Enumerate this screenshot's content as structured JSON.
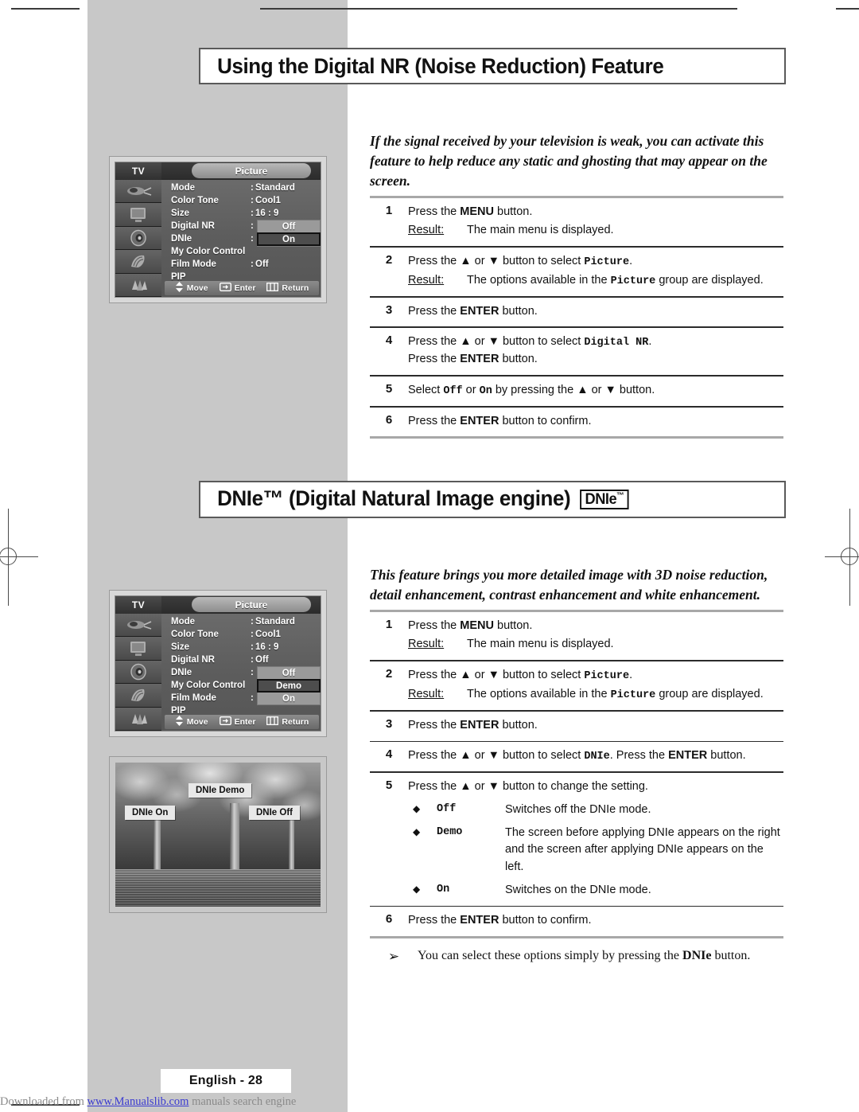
{
  "sections": [
    {
      "title": "Using the Digital NR (Noise Reduction) Feature",
      "intro": "If the signal received by your television is weak, you can activate this feature to help reduce any static and ghosting that may appear on the screen."
    },
    {
      "title": "DNIe™ (Digital Natural Image engine)",
      "logo": "DNIe",
      "logo_tm": "™",
      "intro": "This feature brings you more detailed image with 3D noise reduction, detail enhancement, contrast enhancement and white enhancement."
    }
  ],
  "osd1": {
    "tv_label": "TV",
    "tab_label": "Picture",
    "rows": [
      {
        "label": "Mode",
        "colon": ":",
        "value": "Standard"
      },
      {
        "label": "Color Tone",
        "colon": ":",
        "value": "Cool1"
      },
      {
        "label": "Size",
        "colon": ":",
        "value": "16 : 9"
      },
      {
        "label": "Digital NR",
        "colon": ":",
        "value": ""
      },
      {
        "label": "DNIe",
        "colon": ":",
        "value": ""
      },
      {
        "label": "My Color Control",
        "colon": "",
        "value": ""
      },
      {
        "label": "Film Mode",
        "colon": ":",
        "value": "Off"
      },
      {
        "label": "PIP",
        "colon": "",
        "value": ""
      }
    ],
    "popup": {
      "options": [
        "Off",
        "On"
      ],
      "selected": "On"
    },
    "footer": [
      {
        "icon": "updown-arrow-icon",
        "label": "Move"
      },
      {
        "icon": "enter-icon",
        "label": "Enter"
      },
      {
        "icon": "menu-icon",
        "label": "Return"
      }
    ]
  },
  "osd2": {
    "tv_label": "TV",
    "tab_label": "Picture",
    "rows": [
      {
        "label": "Mode",
        "colon": ":",
        "value": "Standard"
      },
      {
        "label": "Color Tone",
        "colon": ":",
        "value": "Cool1"
      },
      {
        "label": "Size",
        "colon": ":",
        "value": "16 : 9"
      },
      {
        "label": "Digital NR",
        "colon": ":",
        "value": "Off"
      },
      {
        "label": "DNIe",
        "colon": ":",
        "value": ""
      },
      {
        "label": "My Color Control",
        "colon": "",
        "value": ""
      },
      {
        "label": "Film Mode",
        "colon": ":",
        "value": ""
      },
      {
        "label": "PIP",
        "colon": "",
        "value": ""
      }
    ],
    "popup": {
      "options": [
        "Off",
        "Demo",
        "On"
      ],
      "selected": "Demo"
    },
    "footer": [
      {
        "icon": "updown-arrow-icon",
        "label": "Move"
      },
      {
        "icon": "enter-icon",
        "label": "Enter"
      },
      {
        "icon": "menu-icon",
        "label": "Return"
      }
    ]
  },
  "photo": {
    "labels": {
      "demo": "DNIe Demo",
      "on": "DNIe On",
      "off": "DNIe Off"
    }
  },
  "steps1": [
    {
      "n": "1",
      "text_pre": "Press the ",
      "strong": "MENU",
      "text_post": " button.",
      "result_label": "Result:",
      "result_text": "The main menu is displayed."
    },
    {
      "n": "2",
      "text_pre": "Press the ▲ or ▼ button to select ",
      "mono": "Picture",
      "text_post": ".",
      "result_label": "Result:",
      "result_text_pre": "The options available in the ",
      "result_mono": "Picture",
      "result_text_post": " group are displayed."
    },
    {
      "n": "3",
      "text_pre": "Press the ",
      "strong": "ENTER",
      "text_post": " button."
    },
    {
      "n": "4",
      "text_pre": "Press the ▲ or ▼ button to select ",
      "mono": "Digital NR",
      "text_post": ".",
      "line2_pre": "Press the ",
      "line2_strong": "ENTER",
      "line2_post": " button."
    },
    {
      "n": "5",
      "text_pre": "Select ",
      "mono": "Off",
      "mid": " or ",
      "mono2": "On",
      "text_post": " by pressing the ▲ or ▼ button."
    },
    {
      "n": "6",
      "text_pre": "Press the ",
      "strong": "ENTER",
      "text_post": " button to confirm."
    }
  ],
  "steps2": [
    {
      "n": "1",
      "text_pre": "Press the ",
      "strong": "MENU",
      "text_post": " button.",
      "result_label": "Result:",
      "result_text": "The main menu is displayed."
    },
    {
      "n": "2",
      "text_pre": "Press the ▲ or ▼ button to select ",
      "mono": "Picture",
      "text_post": ".",
      "result_label": "Result:",
      "result_text_pre": "The options available in the ",
      "result_mono": "Picture",
      "result_text_post": " group are displayed."
    },
    {
      "n": "3",
      "text_pre": "Press the ",
      "strong": "ENTER",
      "text_post": " button."
    },
    {
      "n": "4",
      "text_pre": "Press the ▲ or ▼ button to select ",
      "mono": "DNIe",
      "text_post": ". Press the ",
      "strong2": "ENTER",
      "text_post2": " button."
    },
    {
      "n": "5",
      "text_pre": "Press the ▲ or ▼ button to change the setting.",
      "options": [
        {
          "bullet": "◆",
          "key": "Off",
          "desc": "Switches off the DNIe mode."
        },
        {
          "bullet": "◆",
          "key": "Demo",
          "desc": "The screen before applying DNIe appears on the right and the screen after applying DNIe appears on the left."
        },
        {
          "bullet": "◆",
          "key": "On",
          "desc": "Switches on the DNIe mode."
        }
      ]
    },
    {
      "n": "6",
      "text_pre": "Press the ",
      "strong": "ENTER",
      "text_post": " button to confirm."
    }
  ],
  "note": {
    "bullet": "➢",
    "text_pre": "You can select these options simply by pressing the ",
    "strong": "DNIe",
    "text_post": " button."
  },
  "footer": {
    "page_label": "English - 28",
    "download_pre": "Downloaded from ",
    "download_link": "www.Manualslib.com",
    "download_post": " manuals search engine"
  }
}
